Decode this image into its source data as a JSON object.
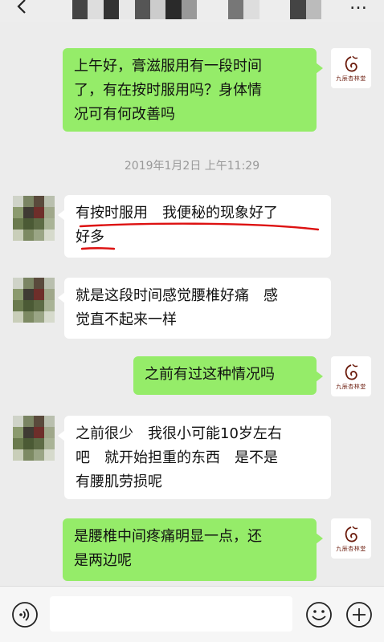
{
  "header": {
    "back_icon": "back-arrow-icon",
    "more_icon": "more-icon",
    "more_label": "…",
    "title_obscured": true
  },
  "messages": [
    {
      "side": "out",
      "text_lines": [
        "上午好，膏滋服用有一段时间",
        "了，有在按时服用吗？身体情",
        "况可有何改善吗"
      ]
    },
    {
      "side": "in",
      "text_lines": [
        "有按时服用　我便秘的现象好了",
        "好多"
      ]
    },
    {
      "side": "in",
      "text_lines": [
        "就是这段时间感觉腰椎好痛　感",
        "觉直不起来一样"
      ]
    },
    {
      "side": "out",
      "text_lines": [
        "之前有过这种情况吗"
      ]
    },
    {
      "side": "in",
      "text_lines": [
        "之前很少　我很小可能10岁左右",
        "吧　就开始担重的东西　是不是",
        "有腰肌劳损呢"
      ]
    },
    {
      "side": "out",
      "text_lines": [
        "是腰椎中间疼痛明显一点，还",
        "是两边呢"
      ]
    }
  ],
  "timestamp": "2019年1月2日 上午11:29",
  "brand_avatar": {
    "text": "九辰杏林堂",
    "color": "#6b1b0c"
  },
  "colors": {
    "outgoing_bubble": "#95ec69",
    "incoming_bubble": "#ffffff",
    "background": "#ececec",
    "underline": "#dd1111"
  },
  "input_bar": {
    "placeholder": "",
    "voice_icon": "voice-icon",
    "emoji_icon": "emoji-icon",
    "plus_icon": "plus-icon"
  }
}
